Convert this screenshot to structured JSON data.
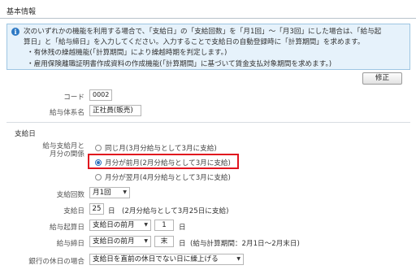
{
  "section": {
    "title": "基本情報"
  },
  "info": {
    "lines": [
      "次のいずれかの機能を利用する場合で、「支給日」の「支給回数」を「月1回」～「月3回」にした場合は、「給与起",
      "算日」と「給与締日」を入力してください。入力することで支給日の自動登録時に「計算期間」を求めます。",
      "・有休残の繰越機能(「計算期間」により繰越時期を判定します。)",
      "・雇用保険離職証明書作成資料の作成機能(「計算期間」に基づいて賃金支払対象期間を求めます。)"
    ]
  },
  "toolbar": {
    "modify_label": "修正"
  },
  "basic": {
    "code_label": "コード",
    "code_value": "0002",
    "system_label": "給与体系名",
    "system_value": "正社員(販売)"
  },
  "payday": {
    "title": "支給日",
    "relation_label_1": "給与支給月と",
    "relation_label_2": "月分の関係",
    "options": [
      {
        "label": "同じ月(3月分給与として3月に支給)",
        "selected": false
      },
      {
        "label": "月分が前月(2月分給与として3月に支給)",
        "selected": true
      },
      {
        "label": "月分が翌月(4月分給与として3月に支給)",
        "selected": false
      }
    ],
    "count_label": "支給回数",
    "count_value": "月1回",
    "day_label": "支給日",
    "day_value": "25",
    "day_unit": "日",
    "day_note": "(2月分給与として3月25日に支給)",
    "start_label": "給与起算日",
    "start_month": "支給日の前月",
    "start_day": "1",
    "start_unit": "日",
    "close_label": "給与締日",
    "close_month": "支給日の前月",
    "close_day": "末",
    "close_unit": "日",
    "close_note": "(給与計算期間：2月1日～2月末日)",
    "holiday_label": "銀行の休日の場合",
    "holiday_value": "支給日を直前の休日でない日に繰上げる"
  }
}
